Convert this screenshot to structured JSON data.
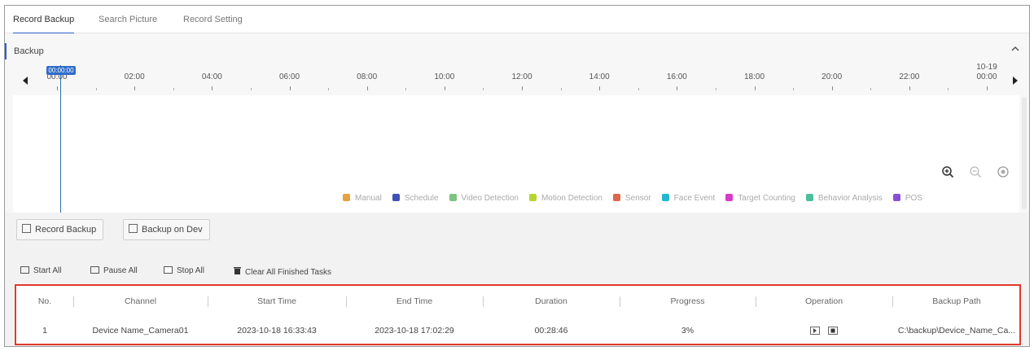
{
  "tabs": [
    {
      "label": "Record Backup",
      "active": true
    },
    {
      "label": "Search Picture",
      "active": false
    },
    {
      "label": "Record Setting",
      "active": false
    }
  ],
  "backup": {
    "label": "Backup",
    "cursor_time": "00:00:00",
    "timeline": {
      "ticks": [
        "00:00",
        "02:00",
        "04:00",
        "06:00",
        "08:00",
        "10:00",
        "12:00",
        "14:00",
        "16:00",
        "18:00",
        "20:00",
        "22:00",
        "00:00"
      ],
      "end_date": "10-19"
    },
    "legend": [
      {
        "label": "Manual",
        "color": "#e6a23c"
      },
      {
        "label": "Schedule",
        "color": "#3f51b5"
      },
      {
        "label": "Video Detection",
        "color": "#7cc47f"
      },
      {
        "label": "Motion Detection",
        "color": "#b6d433"
      },
      {
        "label": "Sensor",
        "color": "#e0664b"
      },
      {
        "label": "Face Event",
        "color": "#22b8cf"
      },
      {
        "label": "Target Counting",
        "color": "#d63bc9"
      },
      {
        "label": "Behavior Analysis",
        "color": "#4cbf9c"
      },
      {
        "label": "POS",
        "color": "#8a4fd6"
      }
    ],
    "icons": [
      "zoom-in-icon",
      "zoom-out-icon",
      "reset-zoom-icon"
    ]
  },
  "buttons": {
    "record_backup": "Record Backup",
    "backup_on_dev": "Backup on Dev"
  },
  "task_actions": {
    "start_all": "Start All",
    "pause_all": "Pause All",
    "stop_all": "Stop All",
    "clear_finished": "Clear All Finished Tasks"
  },
  "table": {
    "columns": [
      "No.",
      "Channel",
      "Start Time",
      "End Time",
      "Duration",
      "Progress",
      "Operation",
      "Backup Path"
    ],
    "rows": [
      {
        "no": "1",
        "channel": "Device Name_Camera01",
        "start_time": "2023-10-18 16:33:43",
        "end_time": "2023-10-18 17:02:29",
        "duration": "00:28:46",
        "progress": "3%",
        "backup_path": "C:\\backup\\Device_Name_Ca..."
      }
    ]
  },
  "accent_color": "#2f5fd3",
  "highlight_color": "#e0392b"
}
